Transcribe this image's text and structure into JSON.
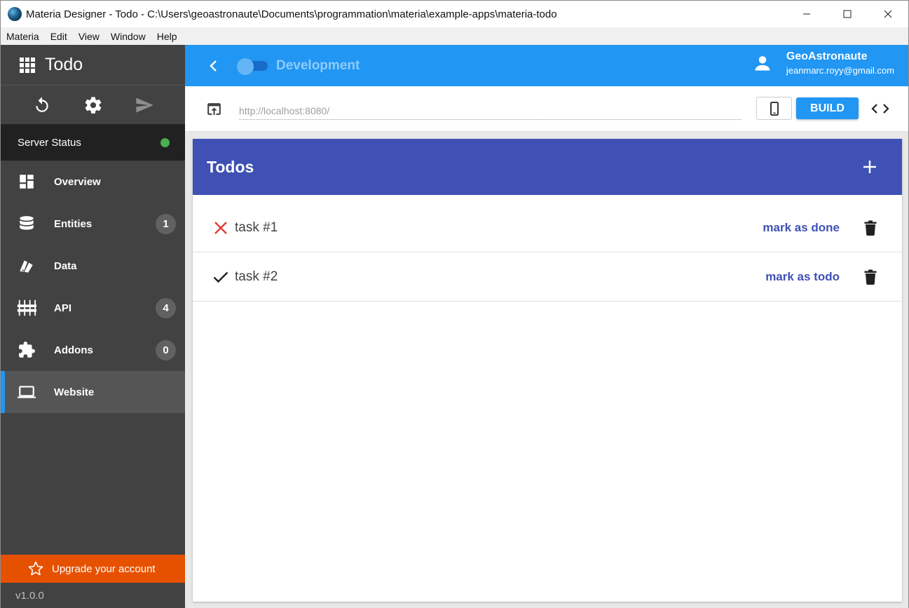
{
  "window": {
    "title": "Materia Designer - Todo - C:\\Users\\geoastronaute\\Documents\\programmation\\materia\\example-apps\\materia-todo"
  },
  "menu": [
    "Materia",
    "Edit",
    "View",
    "Window",
    "Help"
  ],
  "sidebar": {
    "app_name": "Todo",
    "server_status_label": "Server Status",
    "server_status_color": "#4caf50",
    "nav": [
      {
        "label": "Overview",
        "icon": "dashboard-icon"
      },
      {
        "label": "Entities",
        "icon": "database-icon",
        "badge": "1"
      },
      {
        "label": "Data",
        "icon": "swatch-icon"
      },
      {
        "label": "API",
        "icon": "api-icon",
        "badge": "4"
      },
      {
        "label": "Addons",
        "icon": "puzzle-icon",
        "badge": "0"
      },
      {
        "label": "Website",
        "icon": "laptop-icon",
        "active": true
      }
    ],
    "upgrade_label": "Upgrade your account",
    "version": "v1.0.0"
  },
  "topbar": {
    "env_label": "Development",
    "user_name": "GeoAstronaute",
    "user_email": "jeanmarc.royy@gmail.com",
    "accent": "#2196f3"
  },
  "urlbar": {
    "placeholder": "http://localhost:8080/",
    "build_label": "BUILD"
  },
  "preview": {
    "title": "Todos",
    "header_color": "#3f51b5",
    "todos": [
      {
        "label": "task #1",
        "done": false,
        "action": "mark as done"
      },
      {
        "label": "task #2",
        "done": true,
        "action": "mark as todo"
      }
    ]
  }
}
